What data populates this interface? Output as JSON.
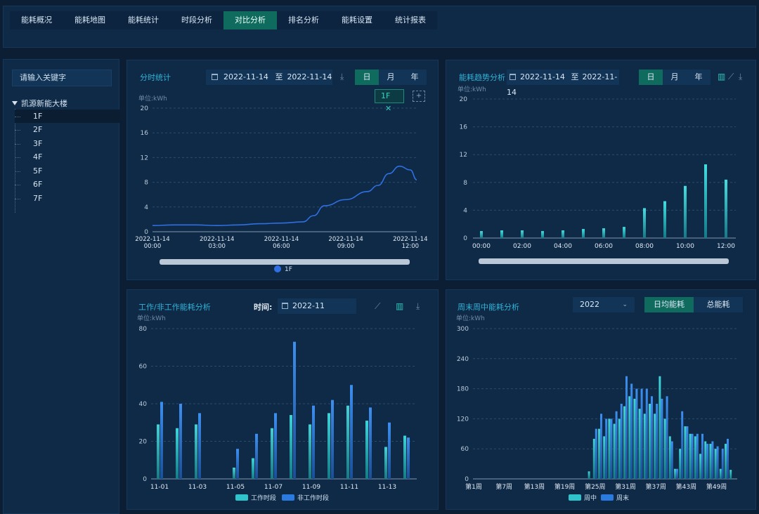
{
  "nav": {
    "items": [
      "能耗概况",
      "能耗地图",
      "能耗统计",
      "时段分析",
      "对比分析",
      "排名分析",
      "能耗设置",
      "统计报表"
    ],
    "active_index": 4
  },
  "sidebar": {
    "search_placeholder": "请输入关键字",
    "root": "凯源新能大楼",
    "floors": [
      "1F",
      "2F",
      "3F",
      "4F",
      "5F",
      "6F",
      "7F"
    ],
    "selected": "1F"
  },
  "panel_hourly": {
    "title": "分时统计",
    "date_from": "2022-11-14",
    "sep": "至",
    "date_to": "2022-11-14",
    "periods": [
      "日",
      "月",
      "年"
    ],
    "active_period": "日",
    "tag": "1F",
    "tag_close": "✕",
    "add": "+",
    "unit": "单位:kWh",
    "legend": "1F"
  },
  "panel_trend": {
    "title": "能耗趋势分析",
    "date_from": "2022-11-14",
    "sep": "至",
    "date_to": "2022-11-14",
    "periods": [
      "日",
      "月",
      "年"
    ],
    "active_period": "日",
    "unit": "单位:kWh"
  },
  "panel_work": {
    "title": "工作/非工作能耗分析",
    "time_label": "时间:",
    "month": "2022-11",
    "unit": "单位:kWh"
  },
  "panel_week": {
    "title": "周末周中能耗分析",
    "year": "2022",
    "modes": [
      "日均能耗",
      "总能耗"
    ],
    "active_mode": "日均能耗",
    "unit": "单位:kWh"
  },
  "colors": {
    "accent": "#0f6b5e",
    "title": "#2fb3d6",
    "line": "#2f6fe0",
    "cyan": "#2fd0d8",
    "blue": "#2a7ae0"
  },
  "chart_data": [
    {
      "type": "line",
      "name": "分时统计",
      "ylim": [
        0,
        20
      ],
      "yticks": [
        0,
        4,
        8,
        12,
        16,
        20
      ],
      "xlim": [
        0,
        12.3
      ],
      "xticks": [
        {
          "v": 0,
          "l1": "2022-11-14",
          "l2": "00:00"
        },
        {
          "v": 3,
          "l1": "2022-11-14",
          "l2": "03:00"
        },
        {
          "v": 6,
          "l1": "2022-11-14",
          "l2": "06:00"
        },
        {
          "v": 9,
          "l1": "2022-11-14",
          "l2": "09:00"
        },
        {
          "v": 12,
          "l1": "2022-11-14",
          "l2": "12:00"
        }
      ],
      "series": [
        {
          "name": "1F",
          "x": [
            0,
            1,
            2,
            3,
            4,
            5,
            6,
            7,
            7.5,
            8,
            9,
            10,
            10.5,
            11,
            11.5,
            12,
            12.3
          ],
          "values": [
            1.0,
            1.1,
            1.1,
            1.0,
            1.1,
            1.3,
            1.4,
            1.6,
            2.6,
            4.2,
            5.2,
            6.5,
            7.5,
            9.4,
            10.6,
            10.0,
            8.4
          ]
        }
      ]
    },
    {
      "type": "bar",
      "name": "能耗趋势分析",
      "ylim": [
        0,
        20
      ],
      "yticks": [
        0,
        4,
        8,
        12,
        16,
        20
      ],
      "categories": [
        "00:00",
        "01:00",
        "02:00",
        "03:00",
        "04:00",
        "05:00",
        "06:00",
        "07:00",
        "08:00",
        "09:00",
        "10:00",
        "11:00",
        "12:00"
      ],
      "tick_labels": [
        "00:00",
        "02:00",
        "04:00",
        "06:00",
        "08:00",
        "10:00",
        "12:00"
      ],
      "values": [
        1.0,
        1.1,
        1.1,
        1.0,
        1.1,
        1.3,
        1.4,
        1.6,
        4.3,
        5.3,
        7.5,
        10.6,
        8.4
      ]
    },
    {
      "type": "bar",
      "name": "工作/非工作能耗分析",
      "ylim": [
        0,
        80
      ],
      "yticks": [
        0,
        20,
        40,
        60,
        80
      ],
      "categories": [
        "11-01",
        "11-02",
        "11-03",
        "11-04",
        "11-05",
        "11-06",
        "11-07",
        "11-08",
        "11-09",
        "11-10",
        "11-11",
        "11-12",
        "11-13",
        "11-14"
      ],
      "tick_labels": [
        "11-01",
        "11-03",
        "11-05",
        "11-07",
        "11-09",
        "11-11",
        "11-13"
      ],
      "series": [
        {
          "name": "工作时段",
          "values": [
            29,
            27,
            29,
            0,
            6,
            11,
            27,
            34,
            29,
            35,
            39,
            31,
            17,
            23
          ]
        },
        {
          "name": "非工作时段",
          "values": [
            41,
            40,
            35,
            0,
            16,
            24,
            35,
            73,
            39,
            42,
            50,
            38,
            30,
            22
          ]
        }
      ]
    },
    {
      "type": "bar",
      "name": "周末周中能耗分析",
      "ylim": [
        0,
        300
      ],
      "yticks": [
        0,
        60,
        120,
        180,
        240,
        300
      ],
      "categories": [
        "第1周",
        "第2周",
        "第3周",
        "第4周",
        "第5周",
        "第6周",
        "第7周",
        "第8周",
        "第9周",
        "第10周",
        "第11周",
        "第12周",
        "第13周",
        "第14周",
        "第15周",
        "第16周",
        "第17周",
        "第18周",
        "第19周",
        "第20周",
        "第21周",
        "第22周",
        "第23周",
        "第24周",
        "第25周",
        "第26周",
        "第27周",
        "第28周",
        "第29周",
        "第30周",
        "第31周",
        "第32周",
        "第33周",
        "第34周",
        "第35周",
        "第36周",
        "第37周",
        "第38周",
        "第39周",
        "第40周",
        "第41周",
        "第42周",
        "第43周",
        "第44周",
        "第45周",
        "第46周",
        "第47周",
        "第48周",
        "第49周",
        "第50周",
        "第51周",
        "第52周"
      ],
      "tick_labels": [
        "第1周",
        "第7周",
        "第13周",
        "第19周",
        "第25周",
        "第31周",
        "第37周",
        "第43周",
        "第49周"
      ],
      "series": [
        {
          "name": "周中",
          "values": [
            0,
            0,
            0,
            0,
            0,
            0,
            0,
            0,
            0,
            0,
            0,
            0,
            0,
            0,
            0,
            0,
            0,
            0,
            0,
            0,
            0,
            0,
            0,
            15,
            80,
            100,
            85,
            120,
            110,
            120,
            145,
            165,
            160,
            140,
            130,
            150,
            130,
            205,
            120,
            85,
            20,
            60,
            105,
            90,
            85,
            50,
            75,
            70,
            60,
            20,
            70,
            18
          ]
        },
        {
          "name": "周末",
          "values": [
            0,
            0,
            0,
            0,
            0,
            0,
            0,
            0,
            0,
            0,
            0,
            0,
            0,
            0,
            0,
            0,
            0,
            0,
            0,
            0,
            0,
            0,
            0,
            0,
            100,
            130,
            120,
            120,
            135,
            150,
            205,
            190,
            180,
            180,
            180,
            165,
            150,
            160,
            165,
            75,
            20,
            135,
            105,
            90,
            90,
            90,
            70,
            75,
            65,
            60,
            80,
            0
          ]
        }
      ]
    }
  ]
}
